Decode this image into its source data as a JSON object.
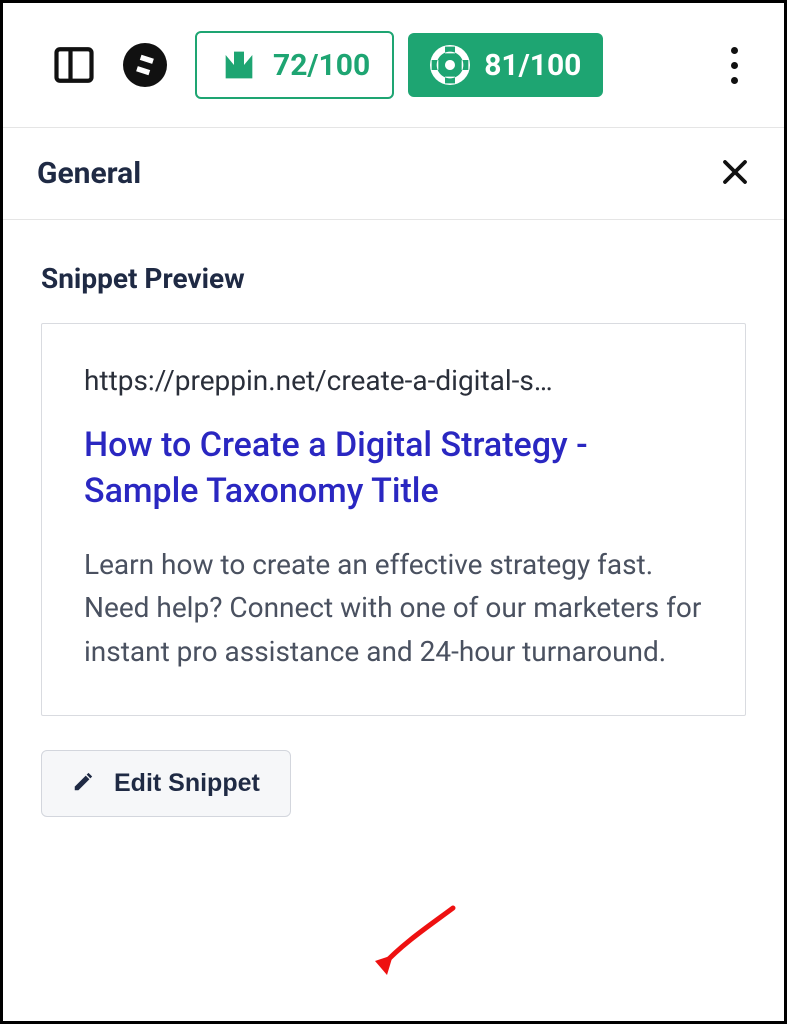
{
  "toolbar": {
    "score1": "72/100",
    "score2": "81/100"
  },
  "section": {
    "title": "General"
  },
  "snippet": {
    "heading": "Snippet Preview",
    "url": "https://preppin.net/create-a-digital-s…",
    "title": "How to Create a Digital Strategy - Sample Taxonomy Title",
    "description": "Learn how to create an effective strategy fast. Need help? Connect with one of our marketers for instant pro assistance and 24-hour turnaround.",
    "edit_label": "Edit Snippet"
  }
}
